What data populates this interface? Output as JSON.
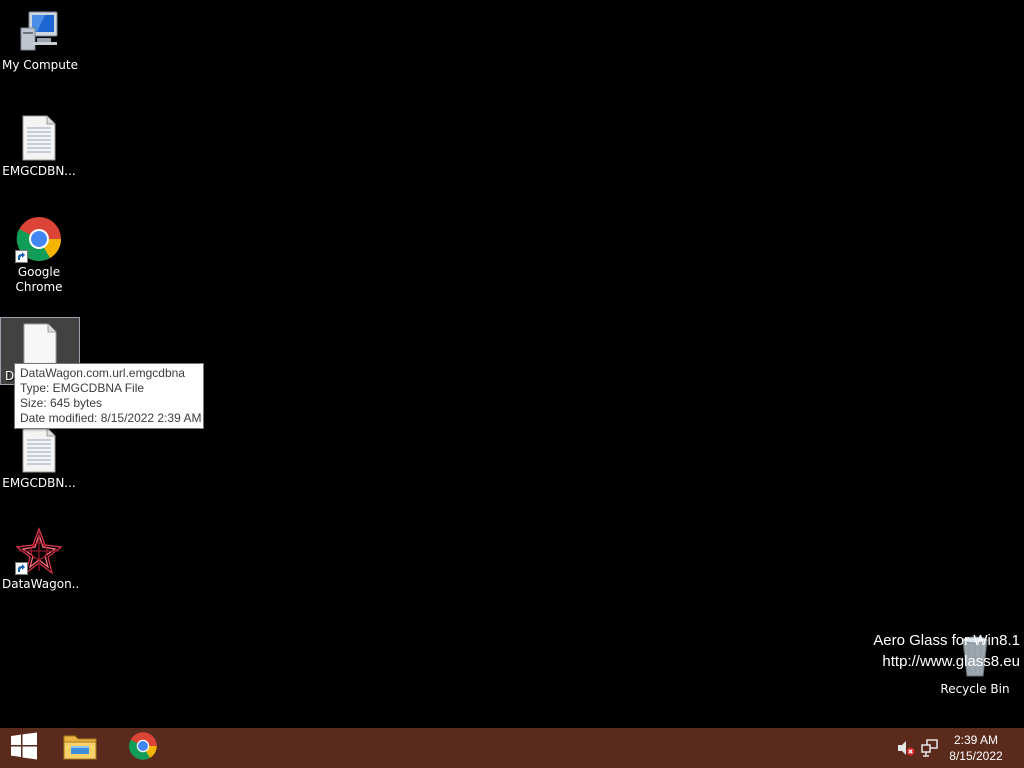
{
  "desktop": {
    "icons": [
      {
        "label": "My Computer",
        "icon": "my-computer-icon"
      },
      {
        "label": "EMGCDBN...",
        "icon": "text-file-icon"
      },
      {
        "label": "Google Chrome",
        "label_line1": "Google",
        "label_line2": "Chrome",
        "icon": "chrome-icon"
      },
      {
        "label": "Da",
        "icon": "blank-file-icon"
      },
      {
        "label": "EMGCDBN...",
        "icon": "text-file-icon"
      },
      {
        "label": "DataWagon...",
        "icon": "datawagon-icon"
      }
    ],
    "recycle_bin": {
      "label": "Recycle Bin",
      "icon": "recycle-bin-icon"
    }
  },
  "tooltip": {
    "name": "DataWagon.com.url.emgcdbna",
    "type": "Type: EMGCDBNA File",
    "size": "Size: 645 bytes",
    "modified": "Date modified: 8/15/2022 2:39 AM"
  },
  "watermark": {
    "line1": "Aero Glass for Win8.1",
    "line2": "http://www.glass8.eu"
  },
  "taskbar": {
    "color": "#5a2a1c",
    "start_icon": "windows-logo-icon",
    "pinned": [
      "file-explorer-icon",
      "chrome-icon"
    ],
    "tray": [
      "volume-muted-icon",
      "network-icon"
    ],
    "time": "2:39 AM",
    "date": "8/15/2022"
  }
}
